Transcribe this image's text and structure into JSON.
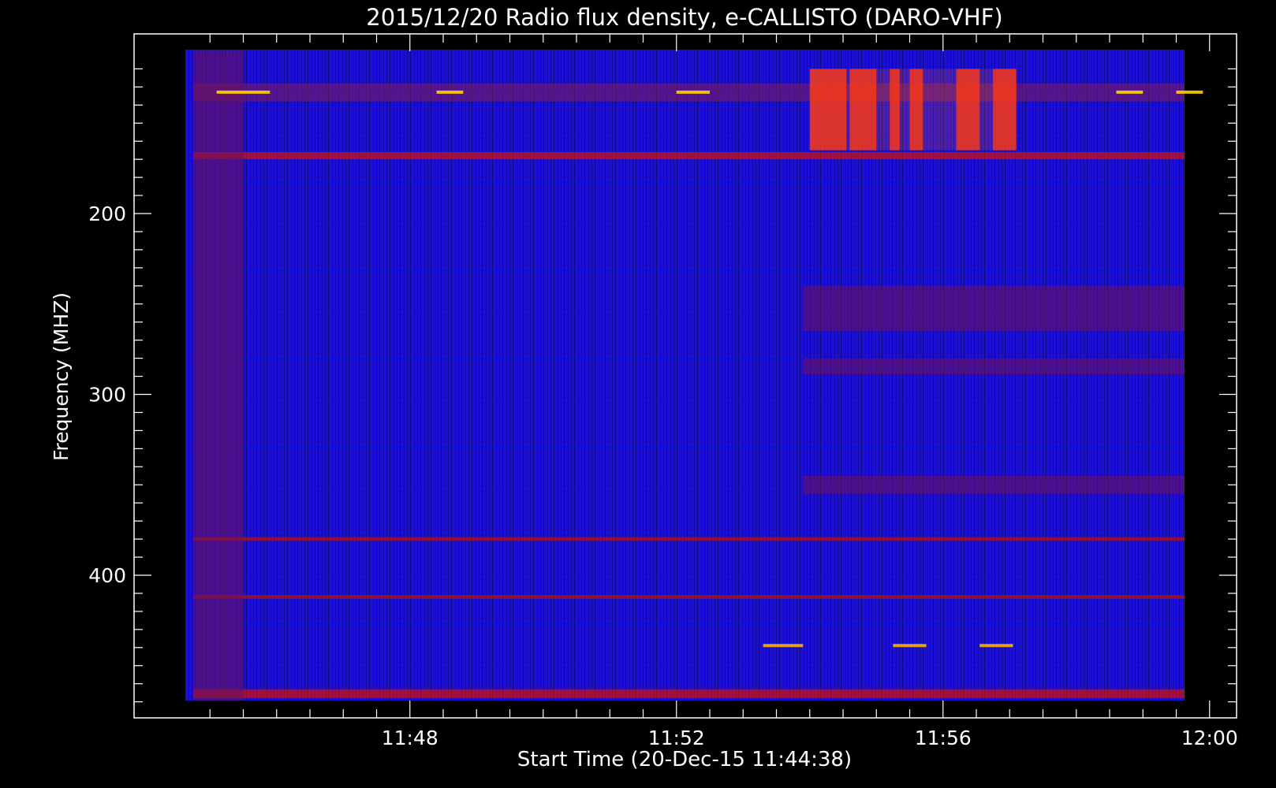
{
  "chart_data": {
    "type": "heatmap",
    "title": "2015/12/20  Radio flux density, e-CALLISTO (DARO-VHF)",
    "xlabel": "Start Time (20-Dec-15 11:44:38)",
    "ylabel": "Frequency (MHZ)",
    "x_ticks": [
      "11:48",
      "11:52",
      "11:56",
      "12:00"
    ],
    "x_tick_values_min": [
      48,
      52,
      56,
      60
    ],
    "xlim_min": [
      44.63,
      60.0
    ],
    "y_ticks": [
      "200",
      "300",
      "400"
    ],
    "y_tick_values": [
      200,
      300,
      400
    ],
    "ylim": [
      110,
      475
    ],
    "colormap": [
      "#000000",
      "#0000ff",
      "#8b0000",
      "#ff2000",
      "#ffd000",
      "#ffffff"
    ],
    "background_level": "blue",
    "features": [
      {
        "kind": "band",
        "freq_mhz": [
          128,
          138
        ],
        "t_min": [
          44.75,
          60.0
        ],
        "level": "mixed"
      },
      {
        "kind": "band",
        "freq_mhz": [
          166,
          170
        ],
        "t_min": [
          44.75,
          60.0
        ],
        "level": "red"
      },
      {
        "kind": "band",
        "freq_mhz": [
          379,
          381
        ],
        "t_min": [
          44.75,
          60.0
        ],
        "level": "red-black"
      },
      {
        "kind": "band",
        "freq_mhz": [
          411,
          413
        ],
        "t_min": [
          44.75,
          60.0
        ],
        "level": "red-black"
      },
      {
        "kind": "band",
        "freq_mhz": [
          463,
          468
        ],
        "t_min": [
          44.75,
          60.0
        ],
        "level": "red"
      },
      {
        "kind": "burst",
        "freq_mhz": [
          120,
          165
        ],
        "t_min": [
          54.0,
          57.1
        ],
        "level": "orange"
      },
      {
        "kind": "patch",
        "freq_mhz": [
          240,
          265
        ],
        "t_min": [
          53.9,
          60.0
        ],
        "level": "dark-red"
      },
      {
        "kind": "patch",
        "freq_mhz": [
          280,
          289
        ],
        "t_min": [
          53.9,
          60.0
        ],
        "level": "dark-red"
      },
      {
        "kind": "patch",
        "freq_mhz": [
          345,
          355
        ],
        "t_min": [
          53.9,
          60.0
        ],
        "level": "dark-red"
      },
      {
        "kind": "column",
        "freq_mhz": [
          110,
          475
        ],
        "t_min": [
          44.75,
          45.5
        ],
        "level": "dark-red"
      }
    ]
  }
}
